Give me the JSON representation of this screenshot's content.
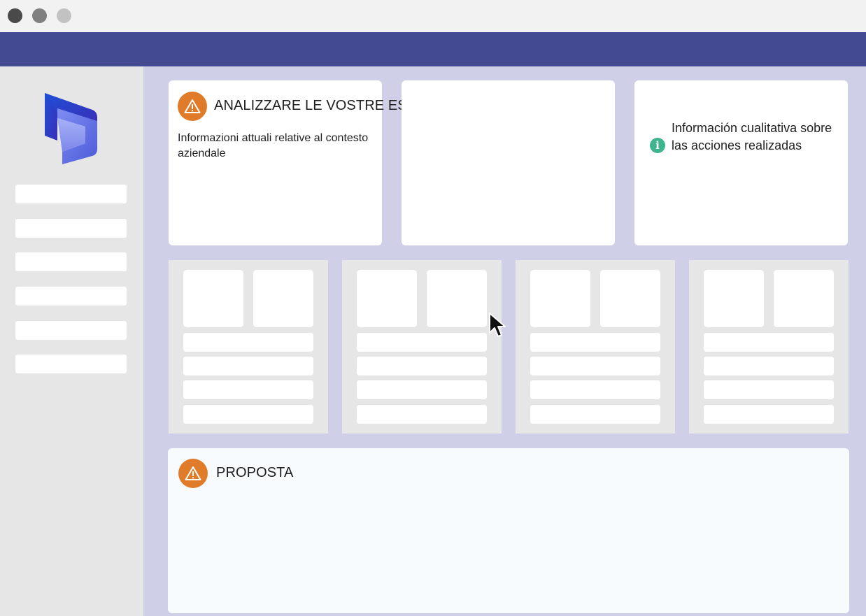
{
  "colors": {
    "header": "#434a91",
    "main_background": "#cfd0e7",
    "sidebar_background": "#e6e6e6",
    "warning_accent": "#e07b2a",
    "info_accent": "#3fb58f"
  },
  "window": {
    "controls": [
      "close-dot",
      "minimize-dot",
      "maximize-dot"
    ]
  },
  "sidebar": {
    "logo_icon": "dynamics-365-logo",
    "items": [
      "",
      "",
      "",
      "",
      "",
      ""
    ]
  },
  "cards": {
    "analyze": {
      "icon": "warning-icon",
      "title": "ANALIZZARE LE VOSTRE ESIGENZE",
      "description": "Informazioni attuali relative al contesto aziendale"
    },
    "info": {
      "icon": "info-icon",
      "icon_glyph": "i",
      "text": "Información cualitativa sobre las acciones realizadas"
    },
    "proposta": {
      "icon": "warning-icon",
      "title": "PROPOSTA"
    }
  },
  "tiles": [
    {
      "thumbs": 2,
      "rows": 4
    },
    {
      "thumbs": 2,
      "rows": 4
    },
    {
      "thumbs": 2,
      "rows": 4
    },
    {
      "thumbs": 2,
      "rows": 4
    }
  ],
  "pointer_icon": "mouse-cursor-icon"
}
